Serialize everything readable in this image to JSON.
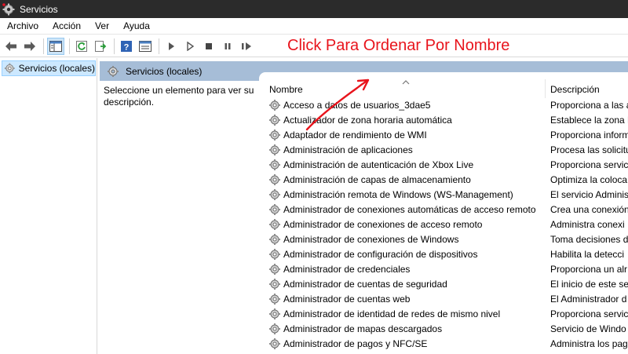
{
  "window": {
    "title": "Servicios"
  },
  "menu": [
    "Archivo",
    "Acción",
    "Ver",
    "Ayuda"
  ],
  "annotation": "Click Para Ordenar Por Nombre",
  "tree": {
    "item": "Servicios (locales)"
  },
  "pane": {
    "title": "Servicios (locales)",
    "description": "Seleccione un elemento para ver su descripción."
  },
  "columns": {
    "name": "Nombre",
    "description": "Descripción"
  },
  "services": [
    {
      "name": "Acceso a datos de usuarios_3dae5",
      "desc": "Proporciona a las a"
    },
    {
      "name": "Actualizador de zona horaria automática",
      "desc": "Establece la zona h"
    },
    {
      "name": "Adaptador de rendimiento de WMI",
      "desc": "Proporciona inform"
    },
    {
      "name": "Administración de aplicaciones",
      "desc": "Procesa las solicitu"
    },
    {
      "name": "Administración de autenticación de Xbox Live",
      "desc": "Proporciona servic"
    },
    {
      "name": "Administración de capas de almacenamiento",
      "desc": "Optimiza la coloca"
    },
    {
      "name": "Administración remota de Windows (WS-Management)",
      "desc": "El servicio Adminis"
    },
    {
      "name": "Administrador de conexiones automáticas de acceso remoto",
      "desc": "Crea una conexión"
    },
    {
      "name": "Administrador de conexiones de acceso remoto",
      "desc": "Administra conexi"
    },
    {
      "name": "Administrador de conexiones de Windows",
      "desc": "Toma decisiones d"
    },
    {
      "name": "Administrador de configuración de dispositivos",
      "desc": "Habilita la detecci"
    },
    {
      "name": "Administrador de credenciales",
      "desc": "Proporciona un alr"
    },
    {
      "name": "Administrador de cuentas de seguridad",
      "desc": "El inicio de este se"
    },
    {
      "name": "Administrador de cuentas web",
      "desc": "El Administrador d"
    },
    {
      "name": "Administrador de identidad de redes de mismo nivel",
      "desc": "Proporciona servic"
    },
    {
      "name": "Administrador de mapas descargados",
      "desc": "Servicio de Windo"
    },
    {
      "name": "Administrador de pagos y NFC/SE",
      "desc": "Administra los pag"
    }
  ],
  "colors": {
    "header_bar": "#a6bdd7",
    "annotation": "#e8141c",
    "selected": "#cce8ff"
  }
}
